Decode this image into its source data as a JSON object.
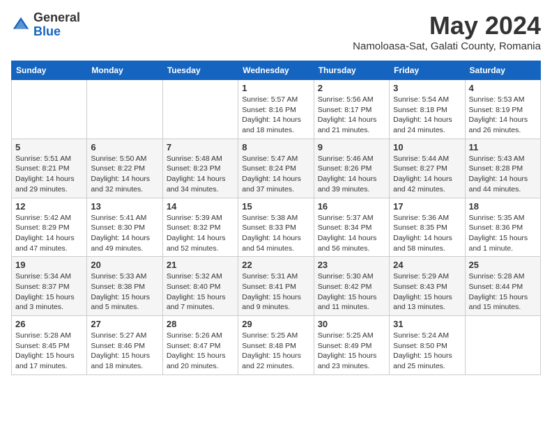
{
  "logo": {
    "general": "General",
    "blue": "Blue"
  },
  "header": {
    "month_title": "May 2024",
    "subtitle": "Namoloasa-Sat, Galati County, Romania"
  },
  "days_of_week": [
    "Sunday",
    "Monday",
    "Tuesday",
    "Wednesday",
    "Thursday",
    "Friday",
    "Saturday"
  ],
  "weeks": [
    [
      {
        "day": "",
        "info": ""
      },
      {
        "day": "",
        "info": ""
      },
      {
        "day": "",
        "info": ""
      },
      {
        "day": "1",
        "info": "Sunrise: 5:57 AM\nSunset: 8:16 PM\nDaylight: 14 hours\nand 18 minutes."
      },
      {
        "day": "2",
        "info": "Sunrise: 5:56 AM\nSunset: 8:17 PM\nDaylight: 14 hours\nand 21 minutes."
      },
      {
        "day": "3",
        "info": "Sunrise: 5:54 AM\nSunset: 8:18 PM\nDaylight: 14 hours\nand 24 minutes."
      },
      {
        "day": "4",
        "info": "Sunrise: 5:53 AM\nSunset: 8:19 PM\nDaylight: 14 hours\nand 26 minutes."
      }
    ],
    [
      {
        "day": "5",
        "info": "Sunrise: 5:51 AM\nSunset: 8:21 PM\nDaylight: 14 hours\nand 29 minutes."
      },
      {
        "day": "6",
        "info": "Sunrise: 5:50 AM\nSunset: 8:22 PM\nDaylight: 14 hours\nand 32 minutes."
      },
      {
        "day": "7",
        "info": "Sunrise: 5:48 AM\nSunset: 8:23 PM\nDaylight: 14 hours\nand 34 minutes."
      },
      {
        "day": "8",
        "info": "Sunrise: 5:47 AM\nSunset: 8:24 PM\nDaylight: 14 hours\nand 37 minutes."
      },
      {
        "day": "9",
        "info": "Sunrise: 5:46 AM\nSunset: 8:26 PM\nDaylight: 14 hours\nand 39 minutes."
      },
      {
        "day": "10",
        "info": "Sunrise: 5:44 AM\nSunset: 8:27 PM\nDaylight: 14 hours\nand 42 minutes."
      },
      {
        "day": "11",
        "info": "Sunrise: 5:43 AM\nSunset: 8:28 PM\nDaylight: 14 hours\nand 44 minutes."
      }
    ],
    [
      {
        "day": "12",
        "info": "Sunrise: 5:42 AM\nSunset: 8:29 PM\nDaylight: 14 hours\nand 47 minutes."
      },
      {
        "day": "13",
        "info": "Sunrise: 5:41 AM\nSunset: 8:30 PM\nDaylight: 14 hours\nand 49 minutes."
      },
      {
        "day": "14",
        "info": "Sunrise: 5:39 AM\nSunset: 8:32 PM\nDaylight: 14 hours\nand 52 minutes."
      },
      {
        "day": "15",
        "info": "Sunrise: 5:38 AM\nSunset: 8:33 PM\nDaylight: 14 hours\nand 54 minutes."
      },
      {
        "day": "16",
        "info": "Sunrise: 5:37 AM\nSunset: 8:34 PM\nDaylight: 14 hours\nand 56 minutes."
      },
      {
        "day": "17",
        "info": "Sunrise: 5:36 AM\nSunset: 8:35 PM\nDaylight: 14 hours\nand 58 minutes."
      },
      {
        "day": "18",
        "info": "Sunrise: 5:35 AM\nSunset: 8:36 PM\nDaylight: 15 hours\nand 1 minute."
      }
    ],
    [
      {
        "day": "19",
        "info": "Sunrise: 5:34 AM\nSunset: 8:37 PM\nDaylight: 15 hours\nand 3 minutes."
      },
      {
        "day": "20",
        "info": "Sunrise: 5:33 AM\nSunset: 8:38 PM\nDaylight: 15 hours\nand 5 minutes."
      },
      {
        "day": "21",
        "info": "Sunrise: 5:32 AM\nSunset: 8:40 PM\nDaylight: 15 hours\nand 7 minutes."
      },
      {
        "day": "22",
        "info": "Sunrise: 5:31 AM\nSunset: 8:41 PM\nDaylight: 15 hours\nand 9 minutes."
      },
      {
        "day": "23",
        "info": "Sunrise: 5:30 AM\nSunset: 8:42 PM\nDaylight: 15 hours\nand 11 minutes."
      },
      {
        "day": "24",
        "info": "Sunrise: 5:29 AM\nSunset: 8:43 PM\nDaylight: 15 hours\nand 13 minutes."
      },
      {
        "day": "25",
        "info": "Sunrise: 5:28 AM\nSunset: 8:44 PM\nDaylight: 15 hours\nand 15 minutes."
      }
    ],
    [
      {
        "day": "26",
        "info": "Sunrise: 5:28 AM\nSunset: 8:45 PM\nDaylight: 15 hours\nand 17 minutes."
      },
      {
        "day": "27",
        "info": "Sunrise: 5:27 AM\nSunset: 8:46 PM\nDaylight: 15 hours\nand 18 minutes."
      },
      {
        "day": "28",
        "info": "Sunrise: 5:26 AM\nSunset: 8:47 PM\nDaylight: 15 hours\nand 20 minutes."
      },
      {
        "day": "29",
        "info": "Sunrise: 5:25 AM\nSunset: 8:48 PM\nDaylight: 15 hours\nand 22 minutes."
      },
      {
        "day": "30",
        "info": "Sunrise: 5:25 AM\nSunset: 8:49 PM\nDaylight: 15 hours\nand 23 minutes."
      },
      {
        "day": "31",
        "info": "Sunrise: 5:24 AM\nSunset: 8:50 PM\nDaylight: 15 hours\nand 25 minutes."
      },
      {
        "day": "",
        "info": ""
      }
    ]
  ]
}
